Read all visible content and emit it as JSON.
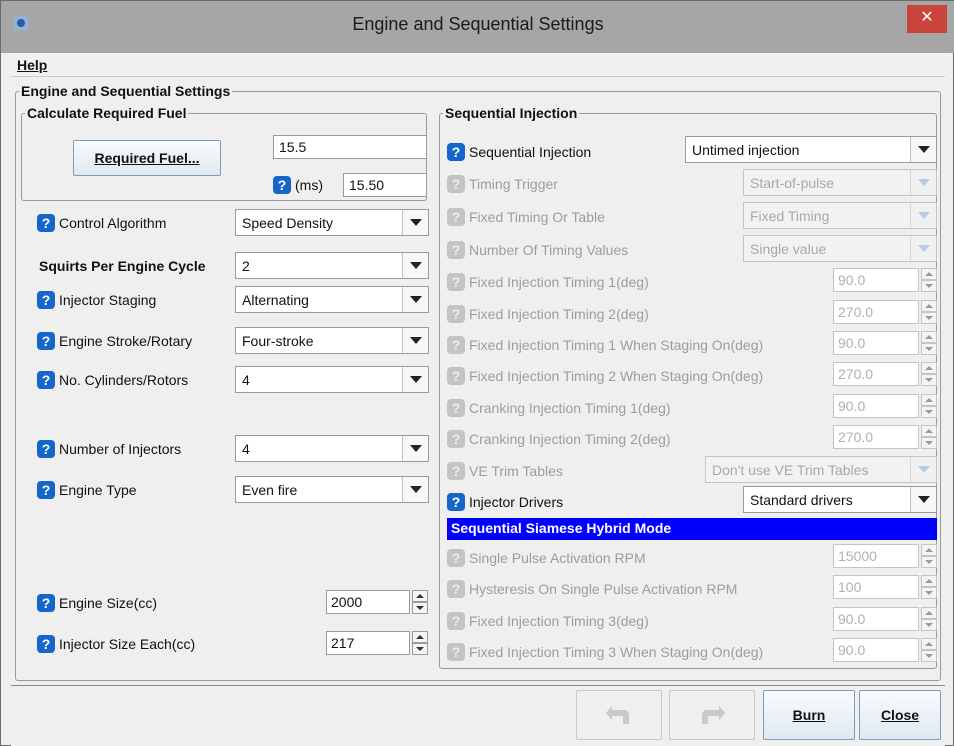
{
  "window": {
    "title": "Engine and Sequential Settings",
    "close_symbol": "✕"
  },
  "menu": {
    "help": "Help"
  },
  "main_group": {
    "legend": "Engine and Sequential Settings"
  },
  "required_fuel": {
    "legend": "Calculate Required Fuel",
    "button": "Required Fuel...",
    "value": "15.5",
    "ms_label": "(ms)",
    "ms_value": "15.50"
  },
  "left": {
    "control_algorithm": {
      "label": "Control Algorithm",
      "value": "Speed Density"
    },
    "squirts": {
      "label": "Squirts Per Engine Cycle",
      "value": "2"
    },
    "injector_staging": {
      "label": "Injector Staging",
      "value": "Alternating"
    },
    "engine_stroke": {
      "label": "Engine Stroke/Rotary",
      "value": "Four-stroke"
    },
    "cylinders": {
      "label": "No. Cylinders/Rotors",
      "value": "4"
    },
    "num_injectors": {
      "label": "Number of Injectors",
      "value": "4"
    },
    "engine_type": {
      "label": "Engine Type",
      "value": "Even fire"
    },
    "engine_size": {
      "label": "Engine Size(cc)",
      "value": "2000"
    },
    "injector_size": {
      "label": "Injector Size Each(cc)",
      "value": "217"
    }
  },
  "sequential": {
    "legend": "Sequential Injection",
    "seq_injection": {
      "label": "Sequential Injection",
      "value": "Untimed injection"
    },
    "timing_trigger": {
      "label": "Timing Trigger",
      "value": "Start-of-pulse"
    },
    "fixed_or_table": {
      "label": "Fixed Timing Or Table",
      "value": "Fixed Timing"
    },
    "num_timing_values": {
      "label": "Number Of Timing Values",
      "value": "Single value"
    },
    "fixed_timing_1": {
      "label": "Fixed Injection Timing 1(deg)",
      "value": "90.0"
    },
    "fixed_timing_2": {
      "label": "Fixed Injection Timing 2(deg)",
      "value": "270.0"
    },
    "fixed_timing_1_staging": {
      "label": "Fixed Injection Timing 1 When Staging On(deg)",
      "value": "90.0"
    },
    "fixed_timing_2_staging": {
      "label": "Fixed Injection Timing 2 When Staging On(deg)",
      "value": "270.0"
    },
    "cranking_timing_1": {
      "label": "Cranking Injection Timing 1(deg)",
      "value": "90.0"
    },
    "cranking_timing_2": {
      "label": "Cranking Injection Timing 2(deg)",
      "value": "270.0"
    },
    "ve_trim": {
      "label": "VE Trim Tables",
      "value": "Don't use VE Trim Tables"
    },
    "injector_drivers": {
      "label": "Injector Drivers",
      "value": "Standard drivers"
    },
    "siamese_banner": "Sequential Siamese Hybrid Mode",
    "single_pulse_rpm": {
      "label": "Single Pulse Activation RPM",
      "value": "15000"
    },
    "hysteresis_rpm": {
      "label": "Hysteresis On Single Pulse Activation RPM",
      "value": "100"
    },
    "fixed_timing_3": {
      "label": "Fixed Injection Timing 3(deg)",
      "value": "90.0"
    },
    "fixed_timing_3_staging": {
      "label": "Fixed Injection Timing 3 When Staging On(deg)",
      "value": "90.0"
    }
  },
  "footer": {
    "burn": "Burn",
    "close": "Close"
  },
  "help_glyph": "?"
}
